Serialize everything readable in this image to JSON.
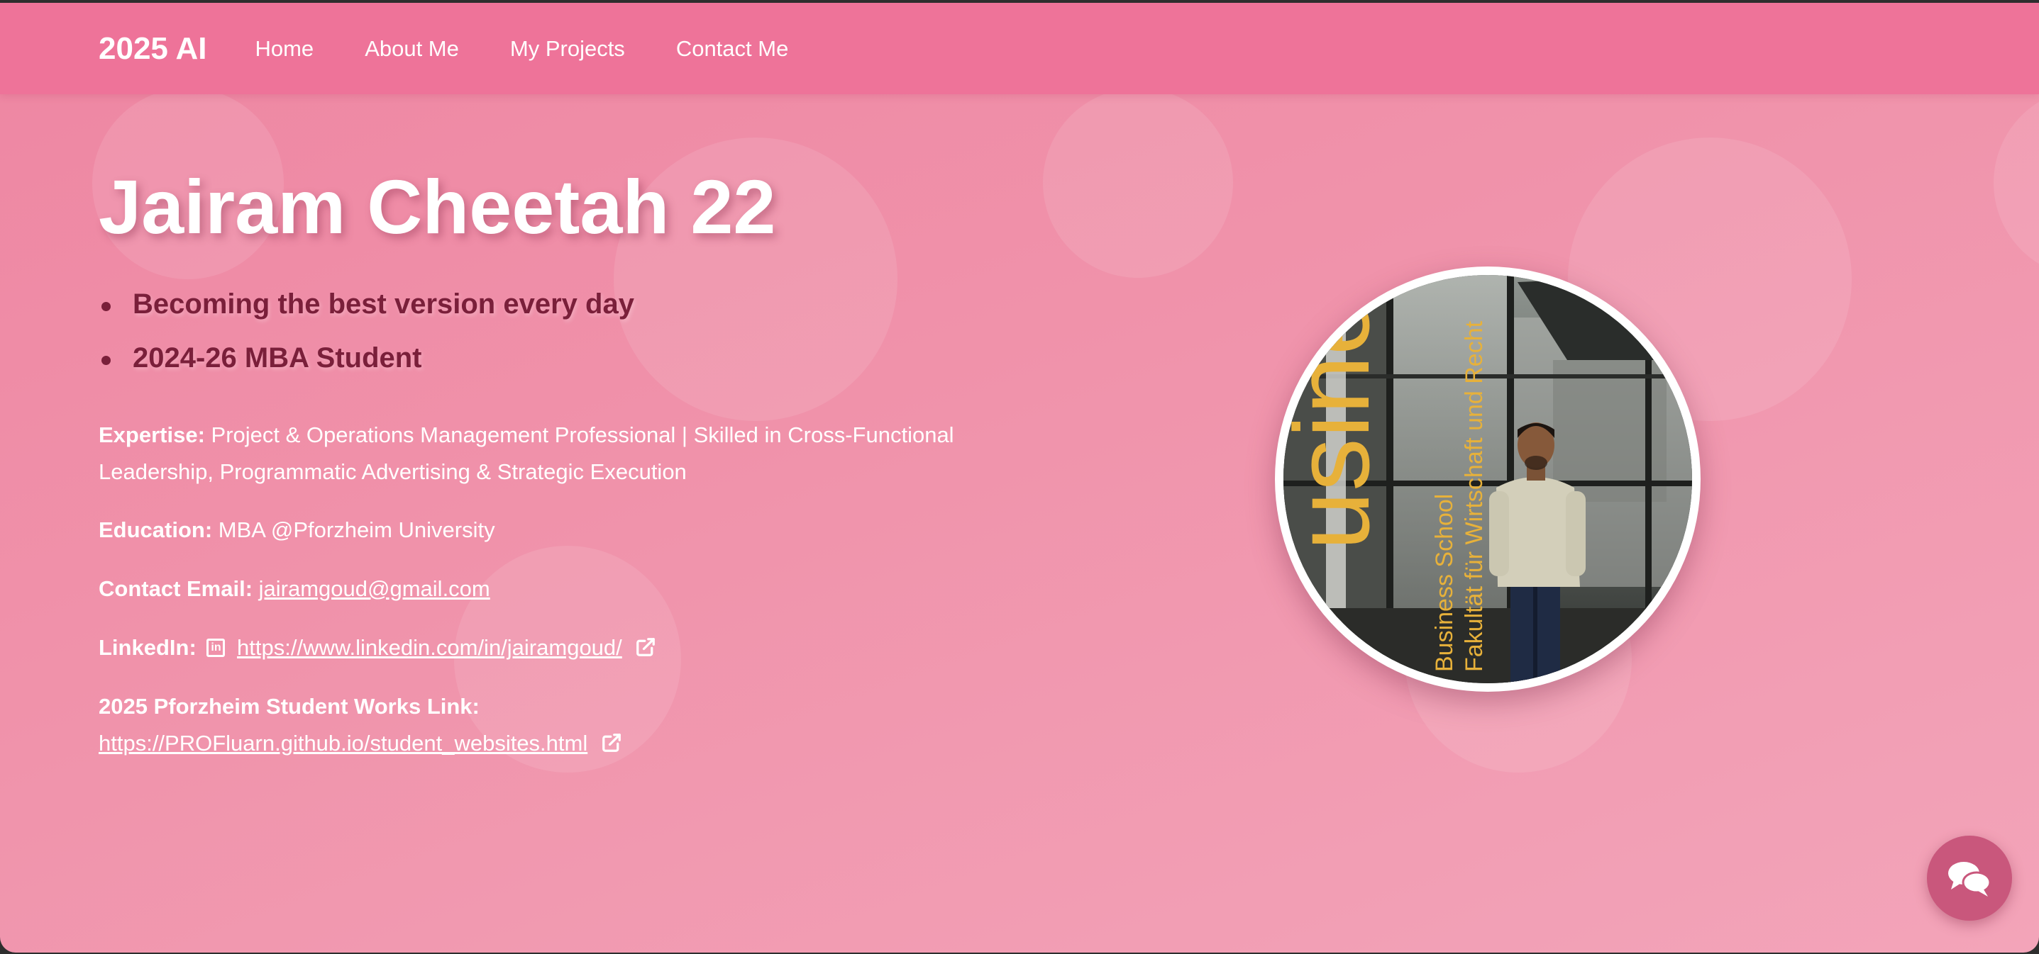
{
  "nav": {
    "brand": "2025 AI",
    "links": [
      "Home",
      "About Me",
      "My Projects",
      "Contact Me"
    ]
  },
  "hero": {
    "title": "Jairam Cheetah 22",
    "taglines": [
      "Becoming the best version every day",
      "2024-26 MBA Student"
    ]
  },
  "info": {
    "expertise_label": "Expertise:",
    "expertise_line1": "Project & Operations Management Professional | Skilled in Cross-Functional",
    "expertise_line2": "Leadership, Programmatic Advertising & Strategic Execution",
    "education_label": "Education:",
    "education_value": "MBA @Pforzheim University",
    "email_label": "Contact Email:",
    "email_value": "jairamgoud@gmail.com",
    "linkedin_label": "LinkedIn:",
    "linkedin_value": "https://www.linkedin.com/in/jairamgoud/",
    "works_label": "2025 Pforzheim Student Works Link:",
    "works_value": "https://PROFluarn.github.io/student_websites.html"
  },
  "photo": {
    "sign_big": "usine",
    "sign_line1": "Business School",
    "sign_line2": "Fakultät für Wirtschaft und Recht"
  },
  "icons": {
    "linkedin": "linkedin-icon",
    "external": "external-link-icon",
    "chat": "chat-bubbles-icon"
  },
  "colors": {
    "navbar": "#ee7399",
    "background": "#f093ab",
    "tagline": "#7a1f3a",
    "chat_button": "#c9577c",
    "sign_text": "#e7b13a"
  }
}
